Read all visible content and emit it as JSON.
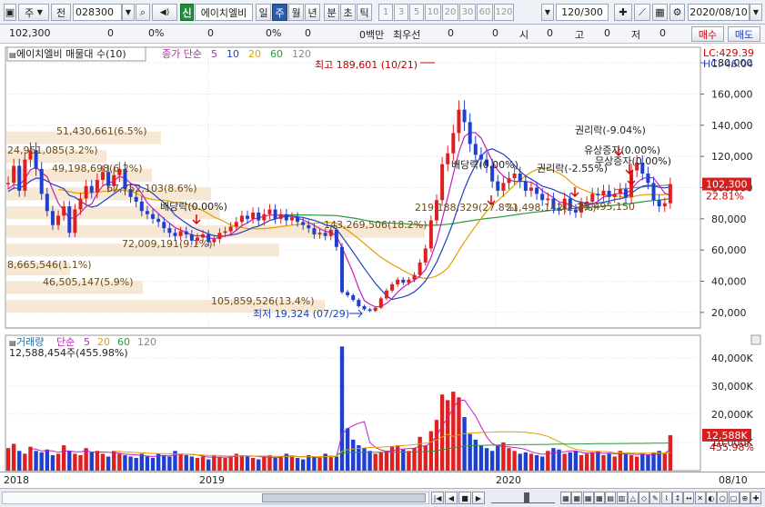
{
  "toolbar": {
    "market": "주",
    "prev": "전",
    "code": "028300",
    "sound": "◀)",
    "new_label": "신",
    "name": "에이치엘비",
    "periods": [
      "일",
      "주",
      "월",
      "년",
      "분",
      "초",
      "틱"
    ],
    "minute_values": [
      "1",
      "3",
      "5",
      "10",
      "20",
      "30",
      "60",
      "120"
    ],
    "count": "120",
    "count_total": "/300",
    "date": "2020/08/10"
  },
  "quote": {
    "price": "102,300",
    "change": "0",
    "change_pct": "0%",
    "vol": "0",
    "vol_pct": "0%",
    "amount": "0",
    "amount_unit": "0백만",
    "best_bid_label": "최우선",
    "bid": "0",
    "ask": "0",
    "open_label": "시",
    "open": "0",
    "high_label": "고",
    "high": "0",
    "low_label": "저",
    "low": "0",
    "buy_label": "매수",
    "sell_label": "매도"
  },
  "price_chart": {
    "title": "에이치엘비 매물대 수(10)",
    "legend_main": "종가 단순",
    "ma_labels": [
      "5",
      "10",
      "20",
      "60",
      "120"
    ],
    "lc_label": "LC:429.39",
    "hc_label": "HC:-46.04",
    "y_ticks": [
      "180,000",
      "160,000",
      "140,000",
      "120,000",
      "100,000",
      "80,000",
      "60,000",
      "40,000",
      "20,000"
    ],
    "current_price": "102,300",
    "current_pct": "22.81%",
    "high_note": "최고 189,601 (10/21)",
    "low_note": "최저 19,324 (07/29)",
    "profile_labels": [
      "51,430,661(6.5%)",
      "24,951,085(3.2%)",
      "49,198,698(6.2%)",
      "67,752,103(8.6%)",
      "72,009,191(9.1%)",
      "143,269,506(18.2%)",
      "219,188,329(27.8%)",
      "21,498,142(2.7%)",
      "35,495,150",
      "8,665,546(1.1%)",
      "46,505,147(5.9%)",
      "105,859,526(13.4%)"
    ],
    "annotations": [
      "배당락(0.00%)",
      "배당락(0.00%)",
      "권리락(-2.55%)",
      "권리락(-9.04%)",
      "유상증자(0.00%)",
      "무상증자(0.00%)"
    ]
  },
  "volume_chart": {
    "title": "거래량",
    "legend_main": "단순",
    "ma_labels": [
      "5",
      "20",
      "60",
      "120"
    ],
    "info": "12,588,454주(455.98%)",
    "y_ticks": [
      "40,000K",
      "30,000K",
      "20,000K",
      "10,000K"
    ],
    "current_vol": "12,588K",
    "current_pct": "455.98%"
  },
  "x_axis": {
    "labels": [
      "2018",
      "2019",
      "2020"
    ],
    "right_label": "08/10"
  },
  "colors": {
    "up": "#e02020",
    "down": "#1f3fd0",
    "ma5": "#c020c0",
    "ma10": "#2040c0",
    "ma20": "#e0a000",
    "ma60": "#2a9a3a",
    "ma120": "#888888",
    "profile": "#f5e6cf"
  },
  "chart_data": {
    "type": "candlestick",
    "title": "에이치엘비 매물대 수(10)",
    "xlabel": "",
    "ylabel": "",
    "ylim": [
      10000,
      190000
    ],
    "x_labels": [
      "2018",
      "2019",
      "2020",
      "08/10"
    ],
    "summary": {
      "high": 189601,
      "high_date": "10/21",
      "low": 19324,
      "low_date": "07/29",
      "last": 102300
    },
    "volume_profile": [
      {
        "level": "51,430,661",
        "pct": 6.5
      },
      {
        "level": "24,951,085",
        "pct": 3.2
      },
      {
        "level": "49,198,698",
        "pct": 6.2
      },
      {
        "level": "67,752,103",
        "pct": 8.6
      },
      {
        "level": "72,009,191",
        "pct": 9.1
      },
      {
        "level": "143,269,506",
        "pct": 18.2
      },
      {
        "level": "219,188,329",
        "pct": 27.8
      },
      {
        "level": "21,498,142",
        "pct": 2.7
      },
      {
        "level": "8,665,546",
        "pct": 1.1
      },
      {
        "level": "46,505,147",
        "pct": 5.9
      },
      {
        "level": "105,859,526",
        "pct": 13.4
      }
    ],
    "close_series": [
      103000,
      114000,
      98000,
      118000,
      124000,
      112000,
      96000,
      85000,
      76000,
      82000,
      88000,
      71000,
      86000,
      93000,
      101000,
      97000,
      105000,
      110000,
      101000,
      108000,
      112000,
      99000,
      94000,
      91000,
      85000,
      83000,
      80000,
      78000,
      74000,
      71000,
      69000,
      72000,
      70000,
      66000,
      68000,
      70000,
      65000,
      67000,
      71000,
      72000,
      75000,
      78000,
      82000,
      80000,
      84000,
      79000,
      83000,
      86000,
      80000,
      83000,
      79000,
      81000,
      78000,
      76000,
      74000,
      70000,
      71000,
      69000,
      73000,
      62000,
      33000,
      31000,
      28000,
      24000,
      22000,
      21000,
      23000,
      29000,
      34000,
      38000,
      41000,
      39000,
      41000,
      44000,
      52000,
      61000,
      79000,
      92000,
      115000,
      122000,
      135000,
      150000,
      142000,
      128000,
      121000,
      118000,
      114000,
      104000,
      98000,
      103000,
      106000,
      109000,
      104000,
      98000,
      100000,
      96000,
      92000,
      93000,
      87000,
      86000,
      93000,
      86000,
      84000,
      90000,
      91000,
      96000,
      95000,
      98000,
      94000,
      96000,
      99000,
      94000,
      111000,
      116000,
      109000,
      103000,
      92000,
      88000,
      90000,
      102300
    ],
    "volume_series_k": [
      8000,
      9500,
      7000,
      6000,
      8500,
      7000,
      6500,
      7500,
      5500,
      6000,
      9000,
      7000,
      6000,
      5500,
      8000,
      6500,
      7000,
      6000,
      5000,
      7000,
      6000,
      5500,
      5000,
      4500,
      6000,
      5000,
      4500,
      6000,
      5500,
      5000,
      7000,
      6000,
      5500,
      5000,
      4500,
      5000,
      4000,
      5500,
      5000,
      4500,
      5000,
      6000,
      5500,
      5000,
      4500,
      4000,
      5000,
      5500,
      4500,
      5000,
      6000,
      5000,
      4500,
      4000,
      5500,
      5000,
      4500,
      6000,
      4800,
      5000,
      44000,
      15000,
      11000,
      9000,
      8000,
      7000,
      6000,
      6500,
      7000,
      8500,
      9000,
      7500,
      7000,
      8000,
      12000,
      9000,
      14000,
      18000,
      27000,
      25000,
      28000,
      26000,
      19000,
      13000,
      11000,
      9000,
      8000,
      7000,
      9000,
      10000,
      8000,
      7000,
      6000,
      6500,
      6000,
      5500,
      5000,
      7000,
      8000,
      7500,
      6000,
      6500,
      7000,
      5500,
      6000,
      6500,
      7000,
      5500,
      6000,
      5000,
      7000,
      6000,
      5500,
      5000,
      6000,
      5500,
      6500,
      7000,
      6000,
      12588
    ]
  }
}
